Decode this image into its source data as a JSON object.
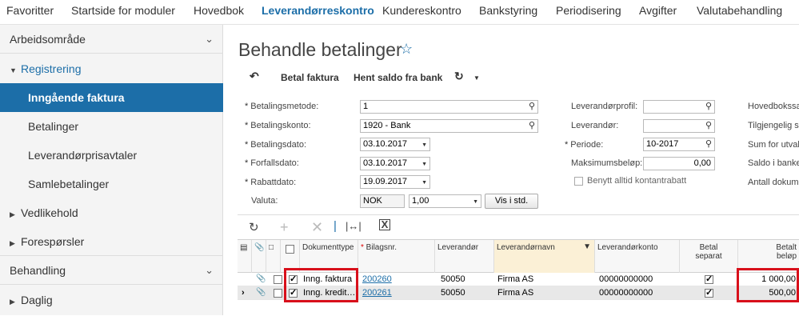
{
  "topnav": {
    "items": [
      "Favoritter",
      "Startside for moduler",
      "Hovedbok",
      "Leverandørreskontro",
      "Kundereskontro",
      "Bankstyring",
      "Periodisering",
      "Avgifter",
      "Valutabehandling"
    ],
    "active_index": 3
  },
  "sidebar": {
    "arbeidsomrade": "Arbeidsområde",
    "registrering": "Registrering",
    "items": [
      "Inngående faktura",
      "Betalinger",
      "Leverandørprisavtaler",
      "Samlebetalinger"
    ],
    "vedlikehold": "Vedlikehold",
    "foresporsler": "Forespørsler",
    "behandling": "Behandling",
    "daglig": "Daglig"
  },
  "page": {
    "title": "Behandle betalinger"
  },
  "toolbar": {
    "undo_icon": "undo-icon",
    "betal_faktura": "Betal faktura",
    "hent_saldo": "Hent saldo fra bank",
    "refresh_icon": "refresh-icon"
  },
  "form": {
    "betalingsmetode_label": "Betalingsmetode:",
    "betalingsmetode_value": "1",
    "betalingskonto_label": "Betalingskonto:",
    "betalingskonto_value": "1920 - Bank",
    "betalingsdato_label": "Betalingsdato:",
    "betalingsdato_value": "03.10.2017",
    "forfallsdato_label": "Forfallsdato:",
    "forfallsdato_value": "03.10.2017",
    "rabattdato_label": "Rabattdato:",
    "rabattdato_value": "19.09.2017",
    "valuta_label": "Valuta:",
    "valuta_value": "NOK",
    "kurs_value": "1,00",
    "vis_i_std": "Vis i std.",
    "leverandorprofil_label": "Leverandørprofil:",
    "leverandor_label": "Leverandør:",
    "periode_label": "Periode:",
    "periode_value": "10-2017",
    "maksimumsbelop_label": "Maksimumsbeløp:",
    "maksimumsbelop_value": "0,00",
    "benytt_label": "Benytt alltid kontantrabatt",
    "right_labels": [
      "Hovedbokssa",
      "Tilgjengelig sa",
      "Sum for utval",
      "Saldo i banke",
      "Antall dokum"
    ]
  },
  "grid": {
    "columns": {
      "dokument": "Dokumenttype",
      "bilagsnr": "Bilagsnr.",
      "leverandor": "Leverandør",
      "leverandornavn": "Leverandørnavn",
      "leverandorkonto": "Leverandørkonto",
      "betal_separat_1": "Betal",
      "betal_separat_2": "separat",
      "betalt_belop_1": "Betalt",
      "betalt_belop_2": "beløp"
    },
    "rows": [
      {
        "dokument": "Inng. faktura",
        "bilagsnr": "200260",
        "leverandor": "50050",
        "leverandornavn": "Firma AS",
        "leverandorkonto": "00000000000",
        "betalt_belop": "1 000,00"
      },
      {
        "dokument": "Inng. kreditnota",
        "bilagsnr": "200261",
        "leverandor": "50050",
        "leverandornavn": "Firma AS",
        "leverandorkonto": "00000000000",
        "betalt_belop": "500,00"
      }
    ]
  }
}
